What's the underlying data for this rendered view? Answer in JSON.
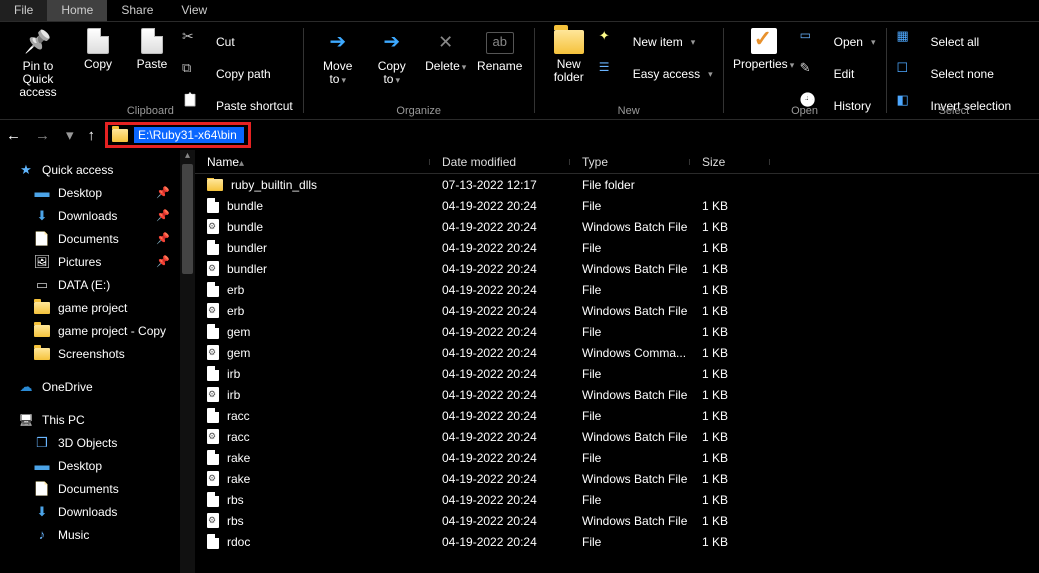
{
  "tabs": {
    "file": "File",
    "home": "Home",
    "share": "Share",
    "view": "View"
  },
  "ribbon": {
    "clipboard": {
      "label": "Clipboard",
      "pin": "Pin to Quick\naccess",
      "copy": "Copy",
      "paste": "Paste",
      "cut": "Cut",
      "copypath": "Copy path",
      "pasteshort": "Paste shortcut"
    },
    "organize": {
      "label": "Organize",
      "moveto": "Move\nto",
      "copyto": "Copy\nto",
      "delete": "Delete",
      "rename": "Rename"
    },
    "new": {
      "label": "New",
      "newfolder": "New\nfolder",
      "newitem": "New item",
      "easy": "Easy access"
    },
    "open": {
      "label": "Open",
      "properties": "Properties",
      "open": "Open",
      "edit": "Edit",
      "history": "History"
    },
    "select": {
      "label": "Select",
      "all": "Select all",
      "none": "Select none",
      "invert": "Invert selection"
    }
  },
  "address": {
    "path": "E:\\Ruby31-x64\\bin"
  },
  "nav": {
    "quick": "Quick access",
    "desktop": "Desktop",
    "downloads": "Downloads",
    "documents": "Documents",
    "pictures": "Pictures",
    "data": "DATA (E:)",
    "gameproj": "game project",
    "gameprojcopy": "game project - Copy",
    "screenshots": "Screenshots",
    "onedrive": "OneDrive",
    "thispc": "This PC",
    "obj3d": "3D Objects",
    "pcdesktop": "Desktop",
    "pcdocs": "Documents",
    "pcdown": "Downloads",
    "pcmusic": "Music"
  },
  "cols": {
    "name": "Name",
    "date": "Date modified",
    "type": "Type",
    "size": "Size"
  },
  "rows": [
    {
      "icon": "folder",
      "name": "ruby_builtin_dlls",
      "date": "07-13-2022 12:17",
      "type": "File folder",
      "size": ""
    },
    {
      "icon": "file",
      "name": "bundle",
      "date": "04-19-2022 20:24",
      "type": "File",
      "size": "1 KB"
    },
    {
      "icon": "bat",
      "name": "bundle",
      "date": "04-19-2022 20:24",
      "type": "Windows Batch File",
      "size": "1 KB"
    },
    {
      "icon": "file",
      "name": "bundler",
      "date": "04-19-2022 20:24",
      "type": "File",
      "size": "1 KB"
    },
    {
      "icon": "bat",
      "name": "bundler",
      "date": "04-19-2022 20:24",
      "type": "Windows Batch File",
      "size": "1 KB"
    },
    {
      "icon": "file",
      "name": "erb",
      "date": "04-19-2022 20:24",
      "type": "File",
      "size": "1 KB"
    },
    {
      "icon": "bat",
      "name": "erb",
      "date": "04-19-2022 20:24",
      "type": "Windows Batch File",
      "size": "1 KB"
    },
    {
      "icon": "file",
      "name": "gem",
      "date": "04-19-2022 20:24",
      "type": "File",
      "size": "1 KB"
    },
    {
      "icon": "bat",
      "name": "gem",
      "date": "04-19-2022 20:24",
      "type": "Windows Comma...",
      "size": "1 KB"
    },
    {
      "icon": "file",
      "name": "irb",
      "date": "04-19-2022 20:24",
      "type": "File",
      "size": "1 KB"
    },
    {
      "icon": "bat",
      "name": "irb",
      "date": "04-19-2022 20:24",
      "type": "Windows Batch File",
      "size": "1 KB"
    },
    {
      "icon": "file",
      "name": "racc",
      "date": "04-19-2022 20:24",
      "type": "File",
      "size": "1 KB"
    },
    {
      "icon": "bat",
      "name": "racc",
      "date": "04-19-2022 20:24",
      "type": "Windows Batch File",
      "size": "1 KB"
    },
    {
      "icon": "file",
      "name": "rake",
      "date": "04-19-2022 20:24",
      "type": "File",
      "size": "1 KB"
    },
    {
      "icon": "bat",
      "name": "rake",
      "date": "04-19-2022 20:24",
      "type": "Windows Batch File",
      "size": "1 KB"
    },
    {
      "icon": "file",
      "name": "rbs",
      "date": "04-19-2022 20:24",
      "type": "File",
      "size": "1 KB"
    },
    {
      "icon": "bat",
      "name": "rbs",
      "date": "04-19-2022 20:24",
      "type": "Windows Batch File",
      "size": "1 KB"
    },
    {
      "icon": "file",
      "name": "rdoc",
      "date": "04-19-2022 20:24",
      "type": "File",
      "size": "1 KB"
    }
  ]
}
